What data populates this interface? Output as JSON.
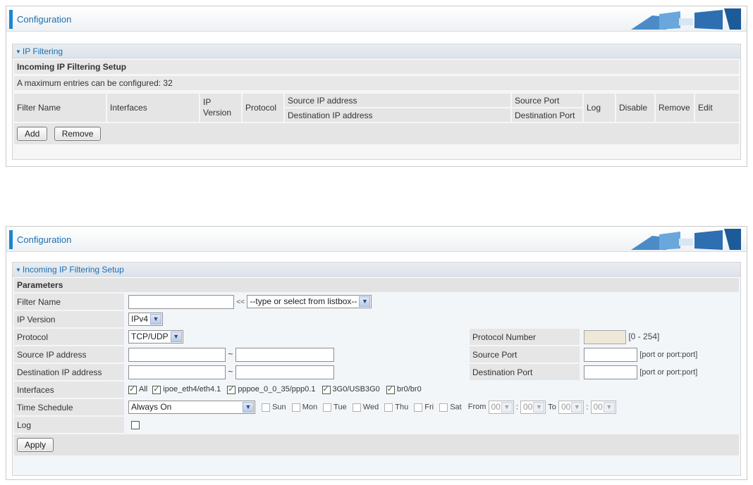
{
  "top_panel": {
    "header_title": "Configuration",
    "section_title": "IP Filtering",
    "setup_title": "Incoming IP Filtering Setup",
    "max_entries": "A maximum entries can be configured: 32",
    "columns": {
      "filter_name": "Filter Name",
      "interfaces": "Interfaces",
      "ip_version": "IP Version",
      "protocol": "Protocol",
      "source_ip": "Source IP address",
      "destination_ip": "Destination IP address",
      "source_port": "Source Port",
      "destination_port": "Destination Port",
      "log": "Log",
      "disable": "Disable",
      "remove": "Remove",
      "edit": "Edit"
    },
    "buttons": {
      "add": "Add",
      "remove": "Remove"
    }
  },
  "bottom_panel": {
    "header_title": "Configuration",
    "section_title": "Incoming IP Filtering Setup",
    "parameters_label": "Parameters",
    "filter_name": {
      "label": "Filter Name",
      "value": "",
      "arrow": "<<",
      "listbox": "--type or select from listbox--"
    },
    "ip_version": {
      "label": "IP Version",
      "value": "IPv4"
    },
    "protocol": {
      "label": "Protocol",
      "value": "TCP/UDP"
    },
    "protocol_number": {
      "label": "Protocol Number",
      "range": "[0 - 254]"
    },
    "source_ip": {
      "label": "Source IP address",
      "sep": "~"
    },
    "destination_ip": {
      "label": "Destination IP address",
      "sep": "~"
    },
    "source_port": {
      "label": "Source Port",
      "hint": "[port or port:port]"
    },
    "destination_port": {
      "label": "Destination Port",
      "hint": "[port or port:port]"
    },
    "interfaces": {
      "label": "Interfaces",
      "items": [
        {
          "label": "All",
          "checked": true
        },
        {
          "label": "ipoe_eth4/eth4.1",
          "checked": true
        },
        {
          "label": "pppoe_0_0_35/ppp0.1",
          "checked": true
        },
        {
          "label": "3G0/USB3G0",
          "checked": true
        },
        {
          "label": "br0/br0",
          "checked": true
        }
      ]
    },
    "time_schedule": {
      "label": "Time Schedule",
      "value": "Always On",
      "days": [
        "Sun",
        "Mon",
        "Tue",
        "Wed",
        "Thu",
        "Fri",
        "Sat"
      ],
      "from_label": "From",
      "to_label": "To",
      "from_hour": "00",
      "from_min": "00",
      "to_hour": "00",
      "to_min": "00",
      "colon": ":"
    },
    "log": {
      "label": "Log"
    },
    "apply": "Apply"
  }
}
